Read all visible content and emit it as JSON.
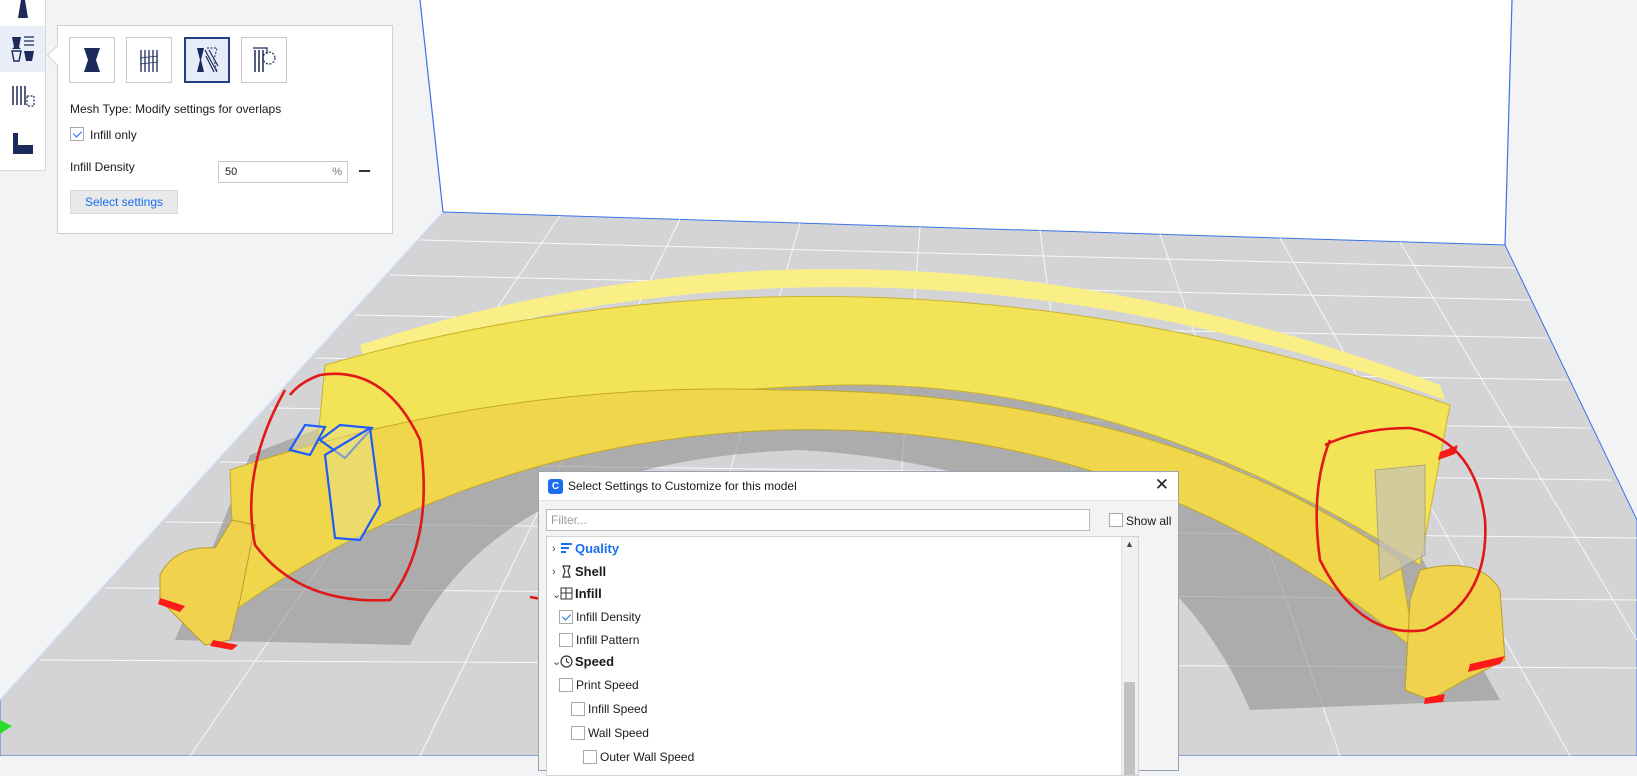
{
  "window": {
    "width": 1637,
    "height": 756
  },
  "colors": {
    "accent": "#196ef0",
    "model_yellow": "#f4e35a",
    "annotation_red": "#e01818",
    "modifier_blue": "#1e5cff",
    "build_plate": "#cfcfd0"
  },
  "toolbar": {
    "tools": [
      {
        "name": "support-blocker-tool",
        "icon": "support-blocker-icon"
      },
      {
        "name": "per-model-settings-tool",
        "icon": "per-model-settings-icon",
        "active": true
      },
      {
        "name": "mesh-tool",
        "icon": "mesh-tool-icon"
      },
      {
        "name": "support-tool",
        "icon": "support-step-icon"
      }
    ]
  },
  "per_model_panel": {
    "mesh_type_buttons": [
      {
        "icon": "normal-model-icon"
      },
      {
        "icon": "support-mesh-icon"
      },
      {
        "icon": "infill-mesh-icon",
        "selected": true
      },
      {
        "icon": "cutting-mesh-icon"
      }
    ],
    "mesh_type_label": "Mesh Type: Modify settings for overlaps",
    "infill_only": {
      "label": "Infill only",
      "checked": true
    },
    "infill_density": {
      "label": "Infill Density",
      "value": "50",
      "unit": "%"
    },
    "select_settings_label": "Select settings"
  },
  "dialog": {
    "title": "Select Settings to Customize for this model",
    "close_glyph": "✕",
    "filter_placeholder": "Filter...",
    "show_all_label": "Show all",
    "show_all_checked": false,
    "tree": [
      {
        "type": "category",
        "label": "Quality",
        "expanded": false,
        "highlight": true
      },
      {
        "type": "category",
        "label": "Shell",
        "expanded": false
      },
      {
        "type": "category",
        "label": "Infill",
        "expanded": true
      },
      {
        "type": "setting",
        "label": "Infill Density",
        "checked": true,
        "indent": 1
      },
      {
        "type": "setting",
        "label": "Infill Pattern",
        "checked": false,
        "indent": 1
      },
      {
        "type": "category",
        "label": "Speed",
        "expanded": true
      },
      {
        "type": "setting",
        "label": "Print Speed",
        "checked": false,
        "indent": 1
      },
      {
        "type": "setting",
        "label": "Infill Speed",
        "checked": false,
        "indent": 2
      },
      {
        "type": "setting",
        "label": "Wall Speed",
        "checked": false,
        "indent": 2
      },
      {
        "type": "setting",
        "label": "Outer Wall Speed",
        "checked": false,
        "indent": 3
      }
    ]
  }
}
